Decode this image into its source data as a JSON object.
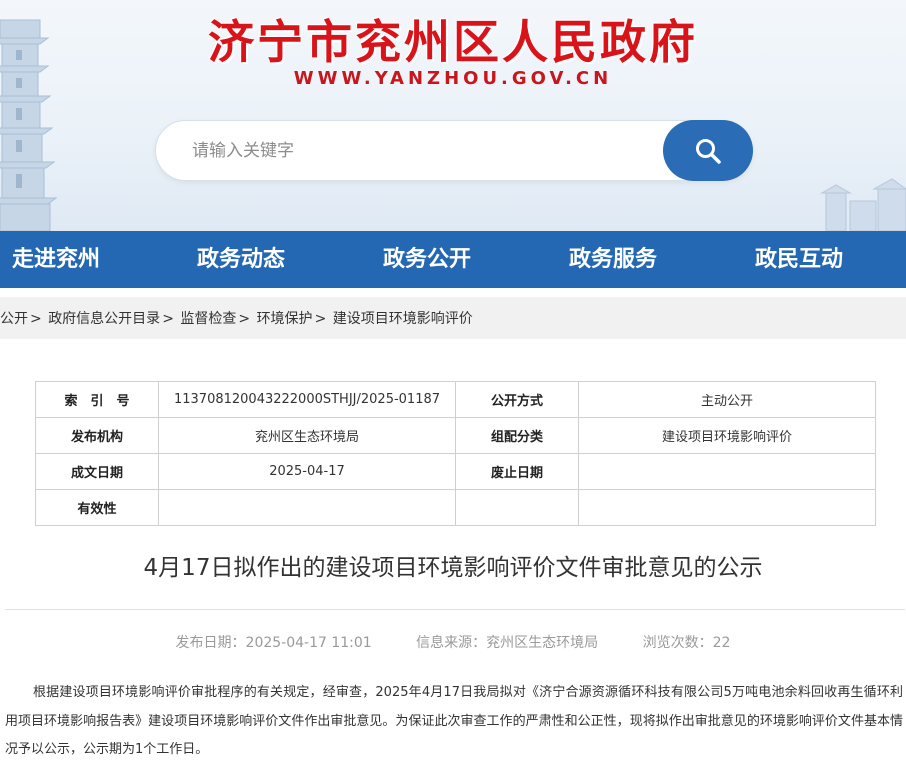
{
  "header": {
    "site_title": "济宁市兖州区人民政府",
    "site_url": "WWW.YANZHOU.GOV.CN"
  },
  "search": {
    "placeholder": "请输入关键字",
    "icon": "search-icon"
  },
  "nav": {
    "items": [
      "走进兖州",
      "政务动态",
      "政务公开",
      "政务服务",
      "政民互动"
    ]
  },
  "breadcrumb": {
    "items": [
      "公开",
      "政府信息公开目录",
      "监督检查",
      "环境保护",
      "建设项目环境影响评价"
    ],
    "separator": ">"
  },
  "info_table": {
    "index_label": "索　引　号",
    "index_value": "11370812004322200​0STHJJ/2025-01187",
    "public_mode_label": "公开方式",
    "public_mode_value": "主动公开",
    "publisher_label": "发布机构",
    "publisher_value": "兖州区生态环境局",
    "category_label": "组配分类",
    "category_value": "建设项目环境影响评价",
    "created_label": "成文日期",
    "created_value": "2025-04-17",
    "abolished_label": "废止日期",
    "abolished_value": "",
    "validity_label": "有效性",
    "validity_value": ""
  },
  "article": {
    "title": "4月17日拟作出的建设项目环境影响评价文件审批意见的公示",
    "publish_date_label": "发布日期：",
    "publish_date": "2025-04-17 11:01",
    "source_label": "信息来源：",
    "source": "兖州区生态环境局",
    "views_label": "浏览次数：",
    "views": "22",
    "body": "根据建设项目环境影响评价审批程序的有关规定，经审查，2025年4月17日我局拟对《济宁合源资源循环科技有限公司5万吨电池余料回收再生循环利用项目环境影响报告表》建设项目环境影响评价文件作出审批意见。为保证此次审查工作的严肃性和公正性，现将拟作出审批意见的环境影响评价文件基本情况予以公示，公示期为1个工作日。"
  },
  "colors": {
    "title_red": "#d8141a",
    "nav_blue": "#2467b3",
    "search_btn_blue": "#2a6cb5"
  }
}
